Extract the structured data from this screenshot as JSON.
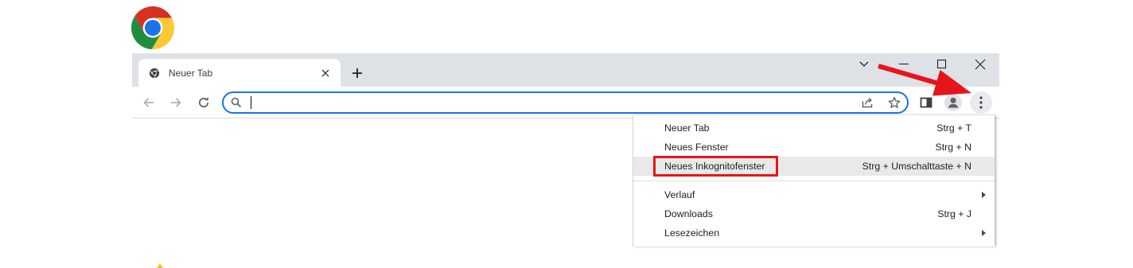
{
  "theme": {
    "accent": "#1a73e8",
    "tabstrip": "#dee1e6",
    "menu_highlight": "#e9e9e9",
    "annotation": "#e8141c"
  },
  "logo": {
    "icon": "chrome-logo-icon",
    "colors": [
      "#d93025",
      "#fcc934",
      "#1e8e3e",
      "#1a73e8"
    ]
  },
  "window": {
    "tabs": [
      {
        "title": "Neuer Tab",
        "favicon": "chrome-favicon-icon",
        "close_icon": "close-icon",
        "active": true
      }
    ],
    "new_tab_icon": "plus-icon",
    "controls": [
      "chevron-down-icon",
      "minimize-icon",
      "maximize-icon",
      "close-icon"
    ]
  },
  "toolbar": {
    "nav": [
      {
        "icon": "arrow-left-icon",
        "enabled": false
      },
      {
        "icon": "arrow-right-icon",
        "enabled": false
      },
      {
        "icon": "reload-icon",
        "enabled": true
      }
    ],
    "omnibox": {
      "value": "",
      "focused": true,
      "leading_icon": "search-icon",
      "trailing_icons": [
        "share-icon",
        "star-icon"
      ]
    },
    "actions": [
      "side-panel-icon",
      "profile-avatar-icon",
      "more-vertical-icon"
    ]
  },
  "menu": {
    "open": true,
    "groups": [
      [
        {
          "label": "Neuer Tab",
          "shortcut": "Strg + T"
        },
        {
          "label": "Neues Fenster",
          "shortcut": "Strg + N"
        },
        {
          "label": "Neues Inkognitofenster",
          "shortcut": "Strg + Umschalttaste + N",
          "highlighted": true
        }
      ],
      [
        {
          "label": "Verlauf",
          "submenu": true
        },
        {
          "label": "Downloads",
          "shortcut": "Strg + J"
        },
        {
          "label": "Lesezeichen",
          "submenu": true
        }
      ]
    ]
  },
  "annotations": {
    "color": "#e8141c"
  }
}
